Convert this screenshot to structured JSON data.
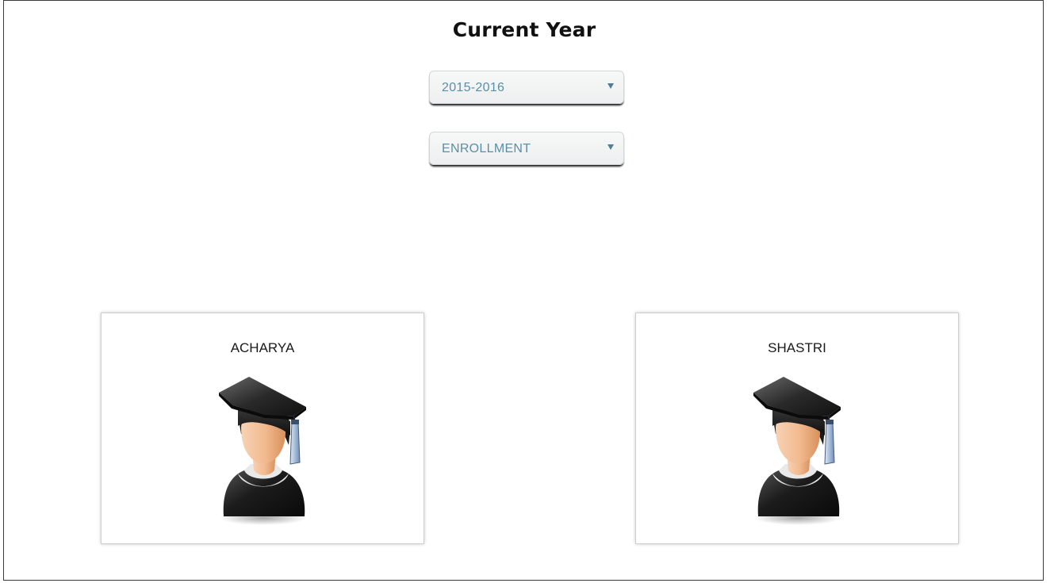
{
  "page": {
    "title": "Current Year"
  },
  "filters": {
    "year": {
      "selected": "2015-2016"
    },
    "category": {
      "selected": "ENROLLMENT"
    }
  },
  "cards": [
    {
      "label": "ACHARYA",
      "icon": "graduate-icon"
    },
    {
      "label": "SHASTRI",
      "icon": "graduate-icon"
    }
  ]
}
